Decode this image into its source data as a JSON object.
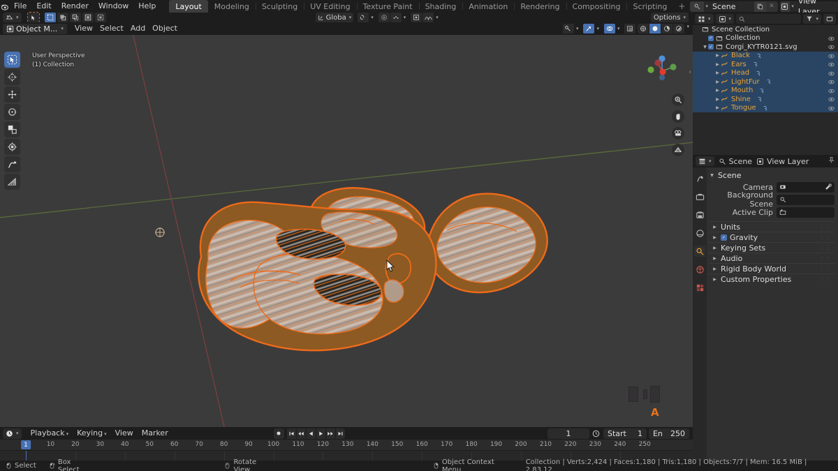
{
  "app": {
    "name": "Blender",
    "version": "2.83.12"
  },
  "topbar": {
    "menus": [
      "File",
      "Edit",
      "Render",
      "Window",
      "Help"
    ],
    "workspaces": [
      {
        "label": "Layout",
        "active": true
      },
      {
        "label": "Modeling",
        "active": false
      },
      {
        "label": "Sculpting",
        "active": false
      },
      {
        "label": "UV Editing",
        "active": false
      },
      {
        "label": "Texture Paint",
        "active": false
      },
      {
        "label": "Shading",
        "active": false
      },
      {
        "label": "Animation",
        "active": false
      },
      {
        "label": "Rendering",
        "active": false
      },
      {
        "label": "Compositing",
        "active": false
      },
      {
        "label": "Scripting",
        "active": false
      }
    ],
    "add_workspace": "+",
    "scene_name": "Scene",
    "view_layer_name": "View Layer"
  },
  "viewport": {
    "mode": "Object M...",
    "menus": [
      "View",
      "Select",
      "Add",
      "Object"
    ],
    "transform_orientation": "Globa",
    "options_label": "Options",
    "overlay_line1": "User Perspective",
    "overlay_line2": "(1) Collection",
    "annotation_letter": "A",
    "background_color": "#3b3b3b",
    "selection_color": "#ed6a1b",
    "tools": [
      {
        "name": "tweak-select-box-tool",
        "active": true
      },
      {
        "name": "cursor-tool",
        "active": false
      },
      {
        "name": "move-tool",
        "active": false
      },
      {
        "name": "rotate-tool",
        "active": false
      },
      {
        "name": "scale-tool",
        "active": false
      },
      {
        "name": "transform-tool",
        "active": false
      },
      {
        "name": "annotate-tool",
        "active": false
      },
      {
        "name": "measure-tool",
        "active": false
      }
    ],
    "shading_modes": [
      {
        "name": "wireframe",
        "active": false
      },
      {
        "name": "solid",
        "active": true
      },
      {
        "name": "material-preview",
        "active": false
      },
      {
        "name": "rendered",
        "active": false
      }
    ]
  },
  "outliner": {
    "display_mode": "View Layer",
    "rows": [
      {
        "label": "Scene Collection",
        "indent": 0,
        "icon": "collection-icon",
        "selected": false,
        "checkbox": false,
        "eye": false,
        "disclosure": "",
        "orange": false
      },
      {
        "label": "Collection",
        "indent": 1,
        "icon": "collection-icon",
        "selected": false,
        "checkbox": true,
        "eye": true,
        "disclosure": "",
        "orange": false
      },
      {
        "label": "Corgi_KYTR0121.svg",
        "indent": 1,
        "icon": "collection-icon",
        "selected": false,
        "checkbox": true,
        "eye": true,
        "disclosure": "down",
        "orange": false
      },
      {
        "label": "Black",
        "indent": 3,
        "icon": "curve-icon",
        "selected": true,
        "checkbox": false,
        "eye": true,
        "disclosure": "right",
        "orange": true
      },
      {
        "label": "Ears",
        "indent": 3,
        "icon": "curve-icon",
        "selected": true,
        "checkbox": false,
        "eye": true,
        "disclosure": "right",
        "orange": true
      },
      {
        "label": "Head",
        "indent": 3,
        "icon": "curve-icon",
        "selected": true,
        "checkbox": false,
        "eye": true,
        "disclosure": "right",
        "orange": true
      },
      {
        "label": "LightFur",
        "indent": 3,
        "icon": "curve-icon",
        "selected": true,
        "checkbox": false,
        "eye": true,
        "disclosure": "right",
        "orange": true
      },
      {
        "label": "Mouth",
        "indent": 3,
        "icon": "curve-icon",
        "selected": true,
        "checkbox": false,
        "eye": true,
        "disclosure": "right",
        "orange": true
      },
      {
        "label": "Shine",
        "indent": 3,
        "icon": "curve-icon",
        "selected": true,
        "checkbox": false,
        "eye": true,
        "disclosure": "right",
        "orange": true
      },
      {
        "label": "Tongue",
        "indent": 3,
        "icon": "curve-icon",
        "selected": true,
        "checkbox": false,
        "eye": true,
        "disclosure": "right",
        "orange": true
      }
    ]
  },
  "properties": {
    "breadcrumb_scene": "Scene",
    "breadcrumb_viewlayer": "View Layer",
    "panel_title": "Scene",
    "fields": [
      {
        "label": "Camera",
        "value": "",
        "icon": "camera-icon",
        "eyedropper": true
      },
      {
        "label": "Background Scene",
        "value": "",
        "icon": "scene-icon",
        "eyedropper": false
      },
      {
        "label": "Active Clip",
        "value": "",
        "icon": "clip-icon",
        "eyedropper": false
      }
    ],
    "sections": [
      {
        "label": "Units",
        "checkbox": false
      },
      {
        "label": "Gravity",
        "checkbox": true
      },
      {
        "label": "Keying Sets",
        "checkbox": false
      },
      {
        "label": "Audio",
        "checkbox": false
      },
      {
        "label": "Rigid Body World",
        "checkbox": false
      },
      {
        "label": "Custom Properties",
        "checkbox": false
      }
    ]
  },
  "timeline": {
    "menus": [
      "Playback",
      "Keying",
      "View",
      "Marker"
    ],
    "current_frame": "1",
    "start_label": "Start",
    "start_value": "1",
    "end_label": "En",
    "end_value": "250",
    "ticks": [
      "10",
      "20",
      "30",
      "40",
      "50",
      "60",
      "70",
      "80",
      "90",
      "100",
      "110",
      "120",
      "130",
      "140",
      "150",
      "160",
      "170",
      "180",
      "190",
      "200",
      "210",
      "220",
      "230",
      "240",
      "250"
    ],
    "playhead_label": "1"
  },
  "statusbar": {
    "hints": [
      {
        "label": "Select",
        "mouse": "left"
      },
      {
        "label": "Box Select",
        "mouse": "left-drag"
      },
      {
        "label": "Rotate View",
        "mouse": "middle"
      },
      {
        "label": "Object Context Menu",
        "mouse": "right"
      }
    ],
    "stats": "Collection | Verts:2,424 | Faces:1,180 | Tris:1,180 | Objects:7/7 | Mem: 16.5 MiB | 2.83.12"
  }
}
